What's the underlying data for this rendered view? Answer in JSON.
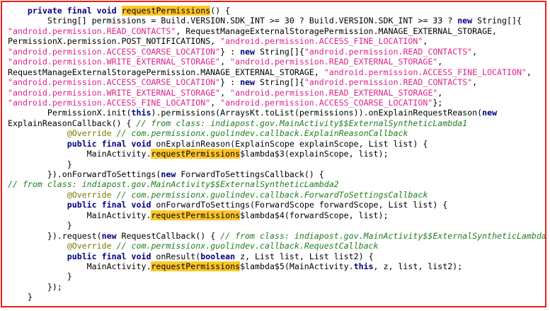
{
  "code_lines": [
    [
      {
        "t": "    "
      },
      {
        "t": "private",
        "c": "kw"
      },
      {
        "t": " "
      },
      {
        "t": "final",
        "c": "kw"
      },
      {
        "t": " "
      },
      {
        "t": "void",
        "c": "kw"
      },
      {
        "t": " "
      },
      {
        "t": "requestPermissions",
        "c": "hl"
      },
      {
        "t": "() {"
      }
    ],
    [
      {
        "t": "        String[] permissions = Build.VERSION.SDK_INT >= 30 ? Build.VERSION.SDK_INT >= 33 ? "
      },
      {
        "t": "new",
        "c": "kw"
      },
      {
        "t": " String[]{"
      }
    ],
    [
      {
        "t": "\"android.permission.READ_CONTACTS\"",
        "c": "str"
      },
      {
        "t": ", RequestManageExternalStoragePermission.MANAGE_EXTERNAL_STORAGE,"
      }
    ],
    [
      {
        "t": "PermissionX.permission.POST_NOTIFICATIONS, "
      },
      {
        "t": "\"android.permission.ACCESS_FINE_LOCATION\"",
        "c": "str"
      },
      {
        "t": ","
      }
    ],
    [
      {
        "t": "\"android.permission.ACCESS_COARSE_LOCATION\"",
        "c": "str"
      },
      {
        "t": "} : "
      },
      {
        "t": "new",
        "c": "kw"
      },
      {
        "t": " String[]{"
      },
      {
        "t": "\"android.permission.READ_CONTACTS\"",
        "c": "str"
      },
      {
        "t": ","
      }
    ],
    [
      {
        "t": "\"android.permission.WRITE_EXTERNAL_STORAGE\"",
        "c": "str"
      },
      {
        "t": ", "
      },
      {
        "t": "\"android.permission.READ_EXTERNAL_STORAGE\"",
        "c": "str"
      },
      {
        "t": ","
      }
    ],
    [
      {
        "t": "RequestManageExternalStoragePermission.MANAGE_EXTERNAL_STORAGE, "
      },
      {
        "t": "\"android.permission.ACCESS_FINE_LOCATION\"",
        "c": "str"
      },
      {
        "t": ","
      }
    ],
    [
      {
        "t": "\"android.permission.ACCESS_COARSE_LOCATION\"",
        "c": "str"
      },
      {
        "t": "} : "
      },
      {
        "t": "new",
        "c": "kw"
      },
      {
        "t": " String[]{"
      },
      {
        "t": "\"android.permission.READ_CONTACTS\"",
        "c": "str"
      },
      {
        "t": ","
      }
    ],
    [
      {
        "t": "\"android.permission.WRITE_EXTERNAL_STORAGE\"",
        "c": "str"
      },
      {
        "t": ", "
      },
      {
        "t": "\"android.permission.READ_EXTERNAL_STORAGE\"",
        "c": "str"
      },
      {
        "t": ","
      }
    ],
    [
      {
        "t": "\"android.permission.ACCESS_FINE_LOCATION\"",
        "c": "str"
      },
      {
        "t": ", "
      },
      {
        "t": "\"android.permission.ACCESS_COARSE_LOCATION\"",
        "c": "str"
      },
      {
        "t": "};"
      }
    ],
    [
      {
        "t": "        PermissionX.init("
      },
      {
        "t": "this",
        "c": "kw"
      },
      {
        "t": ").permissions(ArraysKt.toList(permissions)).onExplainRequestReason("
      },
      {
        "t": "new",
        "c": "kw"
      }
    ],
    [
      {
        "t": "ExplainReasonCallback() { "
      },
      {
        "t": "// from class: indiapost.gov.MainActivity$$ExternalSyntheticLambda1",
        "c": "cmt"
      }
    ],
    [
      {
        "t": "            "
      },
      {
        "t": "@Override",
        "c": "ann"
      },
      {
        "t": " "
      },
      {
        "t": "// com.permissionx.guolindev.callback.ExplainReasonCallback",
        "c": "cmt"
      }
    ],
    [
      {
        "t": "            "
      },
      {
        "t": "public",
        "c": "kw"
      },
      {
        "t": " "
      },
      {
        "t": "final",
        "c": "kw"
      },
      {
        "t": " "
      },
      {
        "t": "void",
        "c": "kw"
      },
      {
        "t": " onExplainReason(ExplainScope explainScope, List list) {"
      }
    ],
    [
      {
        "t": "                MainActivity."
      },
      {
        "t": "requestPermissions",
        "c": "hl"
      },
      {
        "t": "$lambda$3(explainScope, list);"
      }
    ],
    [
      {
        "t": "            }"
      }
    ],
    [
      {
        "t": "        }).onForwardToSettings("
      },
      {
        "t": "new",
        "c": "kw"
      },
      {
        "t": " ForwardToSettingsCallback() {"
      }
    ],
    [
      {
        "t": "// from class: indiapost.gov.MainActivity$$ExternalSyntheticLambda2",
        "c": "cmt"
      }
    ],
    [
      {
        "t": "            "
      },
      {
        "t": "@Override",
        "c": "ann"
      },
      {
        "t": " "
      },
      {
        "t": "// com.permissionx.guolindev.callback.ForwardToSettingsCallback",
        "c": "cmt"
      }
    ],
    [
      {
        "t": "            "
      },
      {
        "t": "public",
        "c": "kw"
      },
      {
        "t": " "
      },
      {
        "t": "final",
        "c": "kw"
      },
      {
        "t": " "
      },
      {
        "t": "void",
        "c": "kw"
      },
      {
        "t": " onForwardToSettings(ForwardScope forwardScope, List list) {"
      }
    ],
    [
      {
        "t": "                MainActivity."
      },
      {
        "t": "requestPermissions",
        "c": "hl"
      },
      {
        "t": "$lambda$4(forwardScope, list);"
      }
    ],
    [
      {
        "t": "            }"
      }
    ],
    [
      {
        "t": "        }).request("
      },
      {
        "t": "new",
        "c": "kw"
      },
      {
        "t": " RequestCallback() { "
      },
      {
        "t": "// from class: indiapost.gov.MainActivity$$ExternalSyntheticLambda3",
        "c": "cmt"
      }
    ],
    [
      {
        "t": "            "
      },
      {
        "t": "@Override",
        "c": "ann"
      },
      {
        "t": " "
      },
      {
        "t": "// com.permissionx.guolindev.callback.RequestCallback",
        "c": "cmt"
      }
    ],
    [
      {
        "t": "            "
      },
      {
        "t": "public",
        "c": "kw"
      },
      {
        "t": " "
      },
      {
        "t": "final",
        "c": "kw"
      },
      {
        "t": " "
      },
      {
        "t": "void",
        "c": "kw"
      },
      {
        "t": " onResult("
      },
      {
        "t": "boolean",
        "c": "kw"
      },
      {
        "t": " z, List list, List list2) {"
      }
    ],
    [
      {
        "t": "                MainActivity."
      },
      {
        "t": "requestPermissions",
        "c": "hl"
      },
      {
        "t": "$lambda$5(MainActivity."
      },
      {
        "t": "this",
        "c": "kw"
      },
      {
        "t": ", z, list, list2);"
      }
    ],
    [
      {
        "t": "            }"
      }
    ],
    [
      {
        "t": "        });"
      }
    ],
    [
      {
        "t": "    }"
      }
    ]
  ],
  "colors": {
    "border": "#e8201b",
    "keyword": "#000080",
    "string": "#e0228c",
    "comment": "#1f7f1f",
    "annotation": "#7a7a00",
    "highlight": "#ffc72a"
  }
}
